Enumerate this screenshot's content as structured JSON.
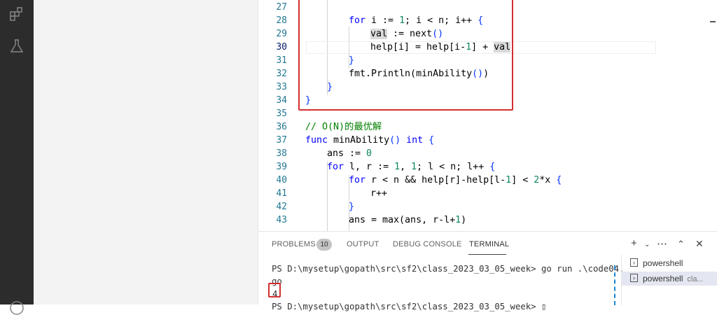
{
  "activity_icons": [
    "extensions-icon",
    "testing-icon",
    "account-icon"
  ],
  "editor": {
    "lines": [
      {
        "n": "27",
        "html": ""
      },
      {
        "n": "28",
        "html": "<span class=\"kw\">for</span> i := <span class=\"nm\">1</span>; i &lt; n; i++ <span class=\"par\">{</span>"
      },
      {
        "n": "29",
        "html": "<span class=\"hl\">val</span> := next<span class=\"par\">()</span>"
      },
      {
        "n": "30",
        "html": "help[i] = help[i-<span class=\"nm\">1</span>] + <span class=\"hl\">val</span>"
      },
      {
        "n": "31",
        "html": "<span class=\"par\">}</span>"
      },
      {
        "n": "32",
        "html": "fmt.Println(minAbility<span class=\"par\">()</span>)"
      },
      {
        "n": "33",
        "html": "<span class=\"par\">}</span>"
      },
      {
        "n": "34",
        "html": "<span class=\"par\">}</span>"
      },
      {
        "n": "35",
        "html": ""
      },
      {
        "n": "36",
        "html": "<span class=\"cm\">// O(N)的最优解</span>"
      },
      {
        "n": "37",
        "html": "<span class=\"kw\">func</span> minAbility<span class=\"par\">()</span> <span class=\"kw\">int</span> <span class=\"par\">{</span>"
      },
      {
        "n": "38",
        "html": "ans := <span class=\"nm\">0</span>"
      },
      {
        "n": "39",
        "html": "<span class=\"kw\">for</span> l, r := <span class=\"nm\">1</span>, <span class=\"nm\">1</span>; l &lt; n; l++ <span class=\"par\">{</span>"
      },
      {
        "n": "40",
        "html": "<span class=\"kw\">for</span> r &lt; n &amp;&amp; help[r]-help[l-<span class=\"nm\">1</span>] &lt; <span class=\"nm\">2</span>*x <span class=\"par\">{</span>"
      },
      {
        "n": "41",
        "html": "r++"
      },
      {
        "n": "42",
        "html": "<span class=\"par\">}</span>"
      },
      {
        "n": "43",
        "html": "ans = max(ans, r-l+<span class=\"nm\">1</span>)"
      }
    ],
    "active_line": "30"
  },
  "panel": {
    "tabs": [
      "PROBLEMS",
      "OUTPUT",
      "DEBUG CONSOLE",
      "TERMINAL"
    ],
    "problems_count": "10",
    "active_tab": "TERMINAL",
    "terminal_lines": [
      "PS D:\\mysetup\\gopath\\src\\sf2\\class_2023_03_05_week> go run .\\code04.",
      "go",
      "4",
      "PS D:\\mysetup\\gopath\\src\\sf2\\class_2023_03_05_week> ▯"
    ],
    "terminals": [
      {
        "name": "powershell",
        "sub": ""
      },
      {
        "name": "powershell",
        "sub": "cla..."
      }
    ]
  }
}
